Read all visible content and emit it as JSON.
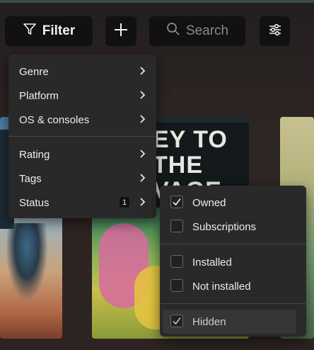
{
  "toolbar": {
    "filter_label": "Filter",
    "search_placeholder": "Search"
  },
  "filter_menu": {
    "items": [
      {
        "label": "Genre"
      },
      {
        "label": "Platform"
      },
      {
        "label": "OS & consoles"
      },
      {
        "label": "Rating"
      },
      {
        "label": "Tags"
      },
      {
        "label": "Status",
        "badge": "1"
      }
    ]
  },
  "status_submenu": {
    "items": [
      {
        "label": "Owned",
        "checked": true
      },
      {
        "label": "Subscriptions",
        "checked": false
      },
      {
        "label": "Installed",
        "checked": false
      },
      {
        "label": "Not installed",
        "checked": false
      },
      {
        "label": "Hidden",
        "checked": true
      }
    ]
  },
  "cards": {
    "middle_title_lines": [
      "EY TO THE",
      "VAGE"
    ]
  },
  "colors": {
    "menu_bg": "#2a2929",
    "button_bg": "#121112",
    "text": "#ececec"
  }
}
